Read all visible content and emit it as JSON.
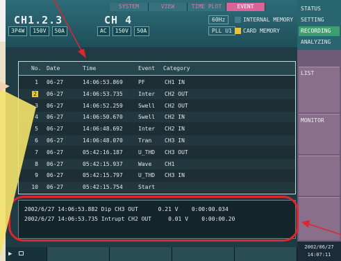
{
  "header": {
    "ch_group_a": "CH1.2.3",
    "ch_group_b": "CH 4",
    "tabs": [
      "SYSTEM",
      "VIEW",
      "TIME PLOT",
      "EVENT"
    ],
    "boxes_a": [
      "3P4W",
      "150V",
      "50A"
    ],
    "boxes_b": [
      "AC",
      "150V",
      "50A"
    ],
    "hz": "60Hz",
    "pll": "PLL U1",
    "internal_memory": "INTERNAL MEMORY",
    "card_memory": "CARD MEMORY"
  },
  "right_menu": {
    "status": "STATUS",
    "setting": "SETTING",
    "recording": "RECORDING",
    "analyzing": "ANALYZING",
    "list": "LIST",
    "monitor": "MONITOR",
    "date": "2002/06/27",
    "time": "14:07:11"
  },
  "table": {
    "headers": {
      "no": "No.",
      "date": "Date",
      "time": "Time",
      "event": "Event",
      "category": "Category"
    },
    "rows": [
      {
        "no": "1",
        "date": "06-27",
        "time": "14:06:53.869",
        "event": "PF",
        "category": "CH1 IN"
      },
      {
        "no": "2",
        "date": "06-27",
        "time": "14:06:53.735",
        "event": "Inter",
        "category": "CH2 OUT"
      },
      {
        "no": "3",
        "date": "06-27",
        "time": "14:06:52.259",
        "event": "Swell",
        "category": "CH2 OUT"
      },
      {
        "no": "4",
        "date": "06-27",
        "time": "14:06:50.670",
        "event": "Swell",
        "category": "CH2 IN"
      },
      {
        "no": "5",
        "date": "06-27",
        "time": "14:06:48.692",
        "event": "Inter",
        "category": "CH2 IN"
      },
      {
        "no": "6",
        "date": "06-27",
        "time": "14:06:48.070",
        "event": "Tran",
        "category": "CH3 IN"
      },
      {
        "no": "7",
        "date": "06-27",
        "time": "05:42:16.187",
        "event": "U_THD",
        "category": "CH3 OUT"
      },
      {
        "no": "8",
        "date": "06-27",
        "time": "05:42:15.937",
        "event": "Wave",
        "category": "CH1"
      },
      {
        "no": "9",
        "date": "06-27",
        "time": "05:42:15.797",
        "event": "U_THD",
        "category": "CH3 IN"
      },
      {
        "no": "10",
        "date": "06-27",
        "time": "05:42:15.754",
        "event": "Start",
        "category": ""
      }
    ]
  },
  "detail": {
    "lines": [
      "2002/6/27 14:06:53.882 Dip CH3 OUT      0.21 V    0:00:00.034",
      "2002/6/27 14:06:53.735 Intrupt CH2 OUT     0.01 V    0:00:00.20"
    ]
  },
  "colors": {
    "screen_bg": "#1f3b44",
    "selection": "#f0c72a",
    "annotation_red": "#e0252d",
    "callout_yellow": "#f3e26a",
    "active_tab": "#d9649a"
  }
}
